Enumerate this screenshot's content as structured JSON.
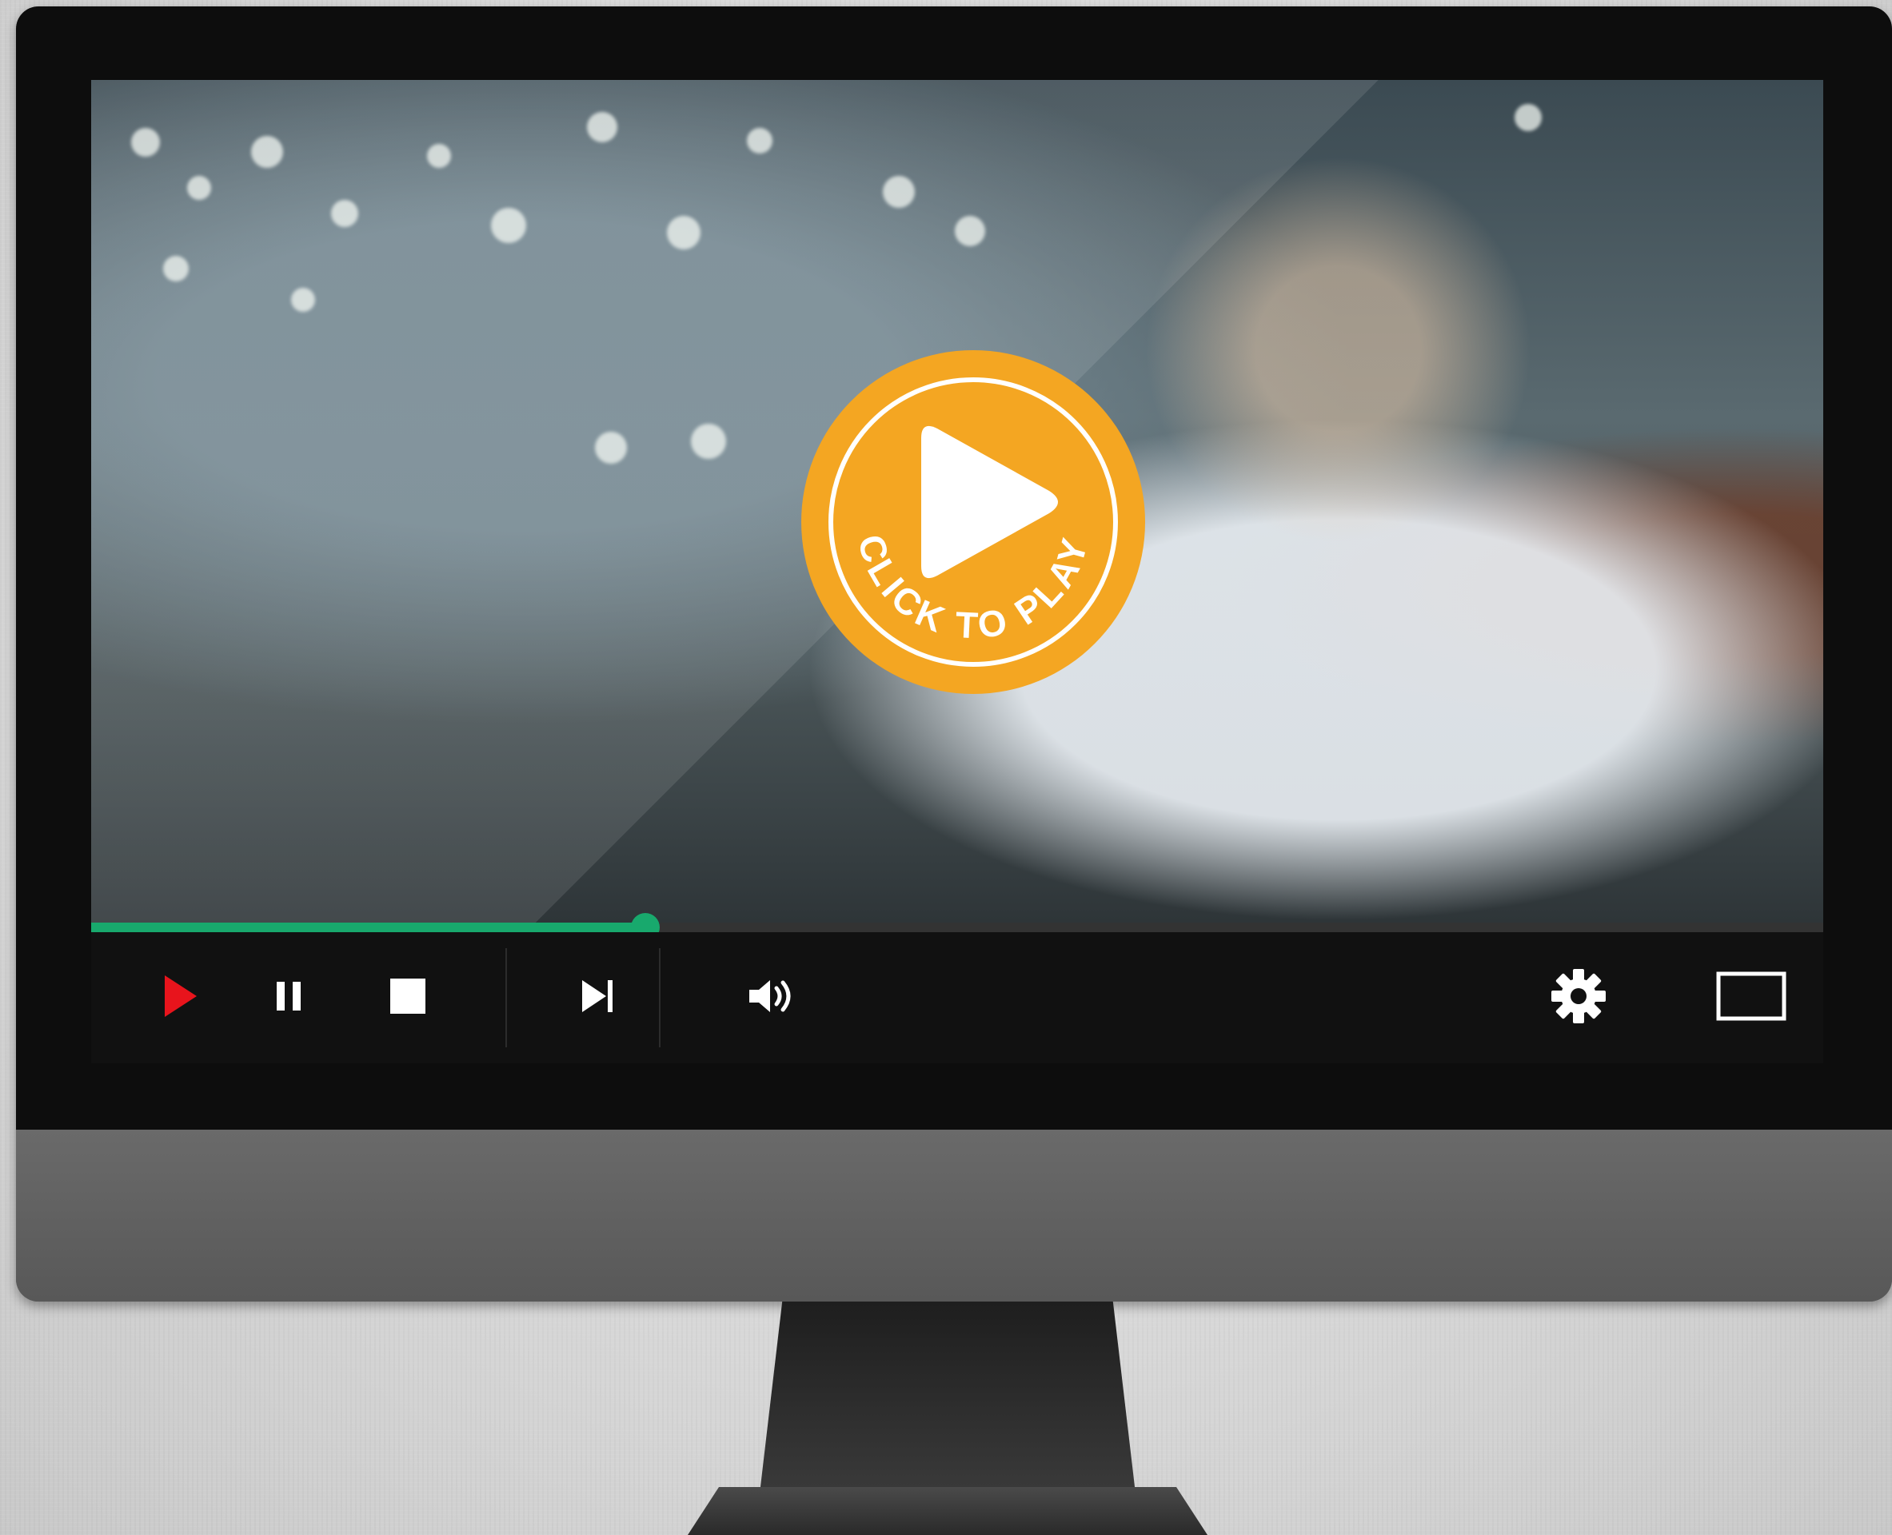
{
  "player": {
    "overlay": {
      "label": "CLICK TO PLAY",
      "color": "#f4a622",
      "icon": "play-icon"
    },
    "progress": {
      "played_fraction": 0.32,
      "color": "#18a96d"
    },
    "controls": {
      "play_icon": "play-icon",
      "pause_icon": "pause-icon",
      "stop_icon": "stop-icon",
      "next_icon": "skip-next-icon",
      "volume_icon": "volume-icon",
      "settings_icon": "gear-icon",
      "fullscreen_icon": "fullscreen-icon",
      "play_color": "#e8141c"
    }
  }
}
